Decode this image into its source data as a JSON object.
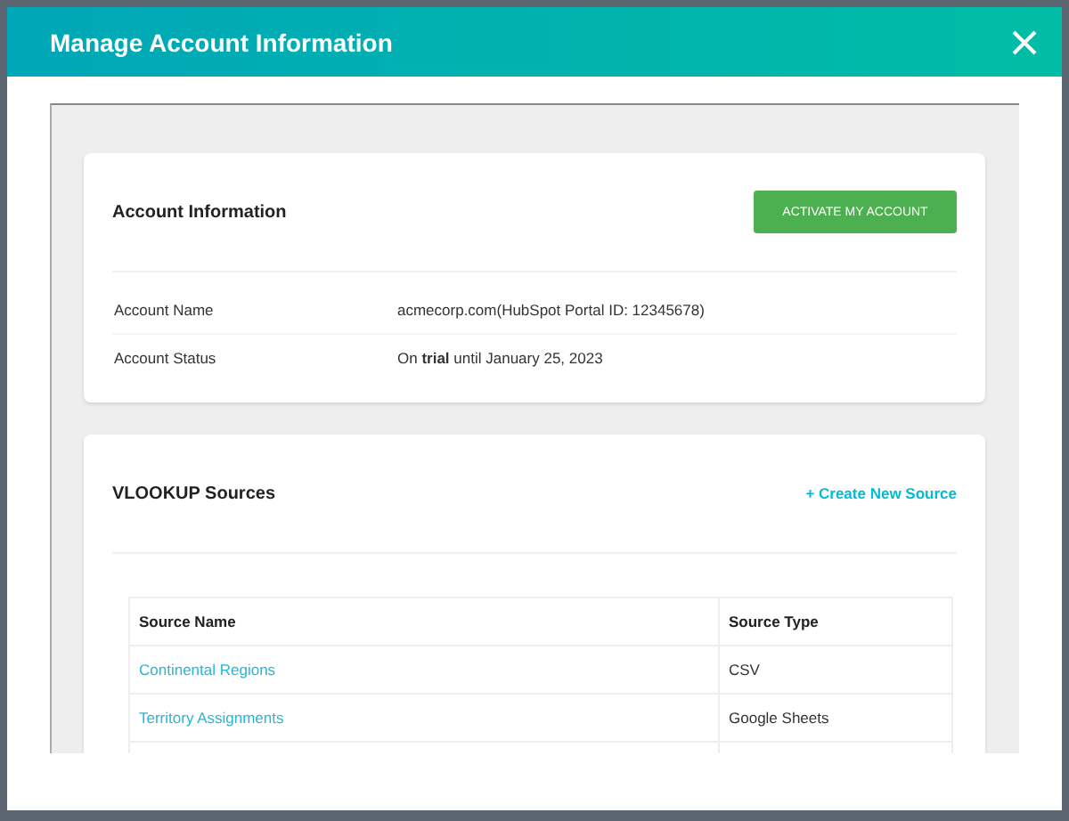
{
  "window": {
    "title": "Manage Account Information"
  },
  "account_card": {
    "title": "Account Information",
    "button": "ACTIVATE MY ACCOUNT",
    "rows": [
      {
        "label": "Account Name",
        "value": "acmecorp.com(HubSpot Portal ID: 12345678)"
      },
      {
        "label": "Account Status",
        "value": "On **trial** until January 25, 2023"
      }
    ]
  },
  "sources_card": {
    "title": "VLOOKUP Sources",
    "link": "+ Create New Source",
    "table": {
      "columns": [
        "Source Name",
        "Source Type"
      ],
      "rows": [
        {
          "name": "Continental Regions",
          "type": "CSV"
        },
        {
          "name": "Territory Assignments",
          "type": "Google Sheets"
        }
      ]
    }
  }
}
